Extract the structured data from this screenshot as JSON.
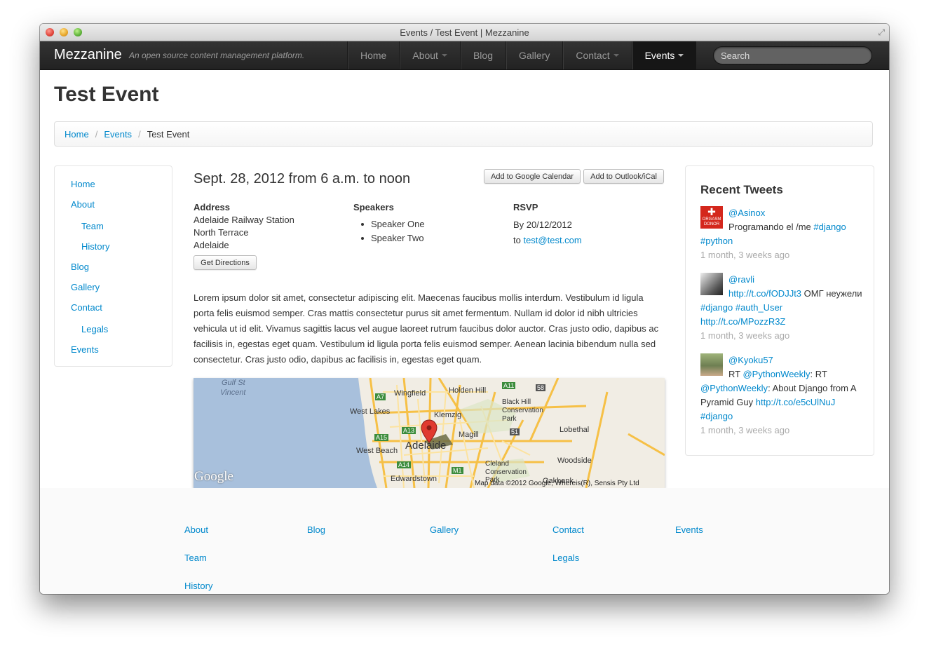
{
  "window": {
    "title": "Events / Test Event | Mezzanine"
  },
  "navbar": {
    "brand": "Mezzanine",
    "tagline": "An open source content management platform.",
    "items": [
      {
        "label": "Home"
      },
      {
        "label": "About"
      },
      {
        "label": "Blog"
      },
      {
        "label": "Gallery"
      },
      {
        "label": "Contact"
      },
      {
        "label": "Events"
      }
    ],
    "search_placeholder": "Search"
  },
  "page": {
    "title": "Test Event"
  },
  "breadcrumb": {
    "home": "Home",
    "events": "Events",
    "current": "Test Event"
  },
  "sidebar": {
    "items": [
      {
        "label": "Home"
      },
      {
        "label": "About"
      },
      {
        "label": "Team"
      },
      {
        "label": "History"
      },
      {
        "label": "Blog"
      },
      {
        "label": "Gallery"
      },
      {
        "label": "Contact"
      },
      {
        "label": "Legals"
      },
      {
        "label": "Events"
      }
    ]
  },
  "event": {
    "date": "Sept. 28, 2012 from 6 a.m. to noon",
    "google_cal_label": "Add to Google Calendar",
    "ical_label": "Add to Outlook/iCal",
    "address_heading": "Address",
    "address_lines": [
      "Adelaide Railway Station",
      "North Terrace",
      "Adelaide"
    ],
    "directions_label": "Get Directions",
    "speakers_heading": "Speakers",
    "speakers": [
      "Speaker One",
      "Speaker Two"
    ],
    "rsvp_heading": "RSVP",
    "rsvp_by": "By 20/12/2012",
    "rsvp_to": "to",
    "rsvp_email": "test@test.com",
    "description": "Lorem ipsum dolor sit amet, consectetur adipiscing elit. Maecenas faucibus mollis interdum. Vestibulum id ligula porta felis euismod semper. Cras mattis consectetur purus sit amet fermentum. Nullam id dolor id nibh ultricies vehicula ut id elit. Vivamus sagittis lacus vel augue laoreet rutrum faucibus dolor auctor. Cras justo odio, dapibus ac facilisis in, egestas eget quam. Vestibulum id ligula porta felis euismod semper. Aenean lacinia bibendum nulla sed consectetur. Cras justo odio, dapibus ac facilisis in, egestas eget quam."
  },
  "map": {
    "labels": {
      "gulf1": "Gulf St",
      "gulf2": "Vincent",
      "holden": "Holden Hill",
      "wingfield": "Wingfield",
      "westlakes": "West Lakes",
      "blackhill1": "Black Hill",
      "blackhill2": "Conservation",
      "blackhill3": "Park",
      "klemzig": "Klemzig",
      "lobethal": "Lobethal",
      "magill": "Magill",
      "westbeach": "West Beach",
      "adelaide": "Adelaide",
      "woodside": "Woodside",
      "cleland1": "Cleland",
      "cleland2": "Conservation",
      "cleland3": "Park",
      "edwardstown": "Edwardstown",
      "oakbank": "Oakbank"
    },
    "roads": {
      "a7": "A7",
      "a11": "A11",
      "a13": "A13",
      "a15": "A15",
      "a14": "A14",
      "m1": "M1",
      "r58": "58",
      "r51": "51"
    },
    "logo": "Google",
    "attribution": "Map data ©2012 Google, Whereis(R), Sensis Pty Ltd"
  },
  "tweets": {
    "heading": "Recent Tweets",
    "items": [
      {
        "handle": "@Asinox",
        "avatar_text": "ORGASM DONOR",
        "pre": "Programando el /me ",
        "tag1": "#django",
        "tag2": "#python",
        "time": "1 month, 3 weeks ago"
      },
      {
        "handle": "@ravli",
        "link1": "http://t.co/fODJJt3",
        "text1": " ОМГ неужели ",
        "tag1": "#django",
        "tag2": "#auth_User",
        "link2": "http://t.co/MPozzR3Z",
        "time": "1 month, 3 weeks ago"
      },
      {
        "handle": "@Kyoku57",
        "rt": "RT ",
        "mention1": "@PythonWeekly",
        "colon": ": RT",
        "mention2": "@PythonWeekly",
        "text": ": About Django from A Pyramid Guy ",
        "link": "http://t.co/e5cUlNuJ",
        "tag": "#django",
        "time": "1 month, 3 weeks ago"
      }
    ]
  },
  "footer": {
    "about": "About",
    "team": "Team",
    "history": "History",
    "blog": "Blog",
    "gallery": "Gallery",
    "contact": "Contact",
    "legals": "Legals",
    "events": "Events"
  },
  "colors": {
    "link": "#0088cc",
    "navbar": "#222222",
    "water": "#a8c0dc",
    "land": "#f1ede4",
    "road": "#f6c046"
  }
}
